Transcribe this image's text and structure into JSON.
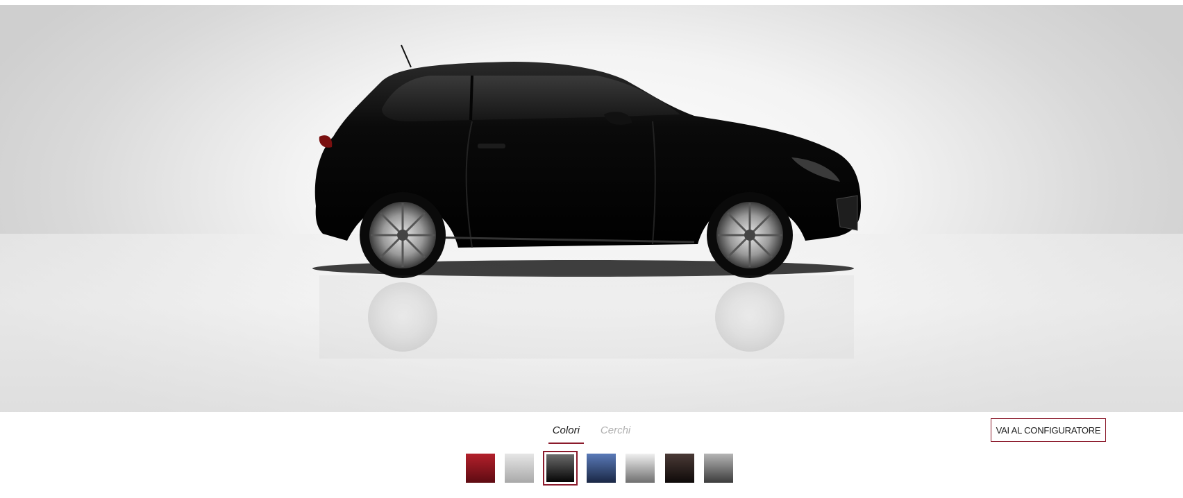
{
  "tabs": {
    "colors_label": "Colori",
    "wheels_label": "Cerchi",
    "active": "Colori"
  },
  "cta": {
    "label": "VAI AL CONFIGURATORE"
  },
  "swatches": [
    {
      "name": "red",
      "top": "#b3202b",
      "bottom": "#5e0b12",
      "selected": false
    },
    {
      "name": "silver-light",
      "top": "#e6e6e6",
      "bottom": "#a9a9a9",
      "selected": false
    },
    {
      "name": "black",
      "top": "#6b6b6b",
      "bottom": "#050505",
      "selected": true
    },
    {
      "name": "blue",
      "top": "#5a7ab8",
      "bottom": "#1a2745",
      "selected": false
    },
    {
      "name": "silver",
      "top": "#f0f0f0",
      "bottom": "#6f6f6f",
      "selected": false
    },
    {
      "name": "dark-brown",
      "top": "#4a3a36",
      "bottom": "#0f0a09",
      "selected": false
    },
    {
      "name": "gunmetal",
      "top": "#b5b5b5",
      "bottom": "#3c3c3c",
      "selected": false
    }
  ],
  "car": {
    "color": "#0b0b0b",
    "view": "side-profile"
  }
}
